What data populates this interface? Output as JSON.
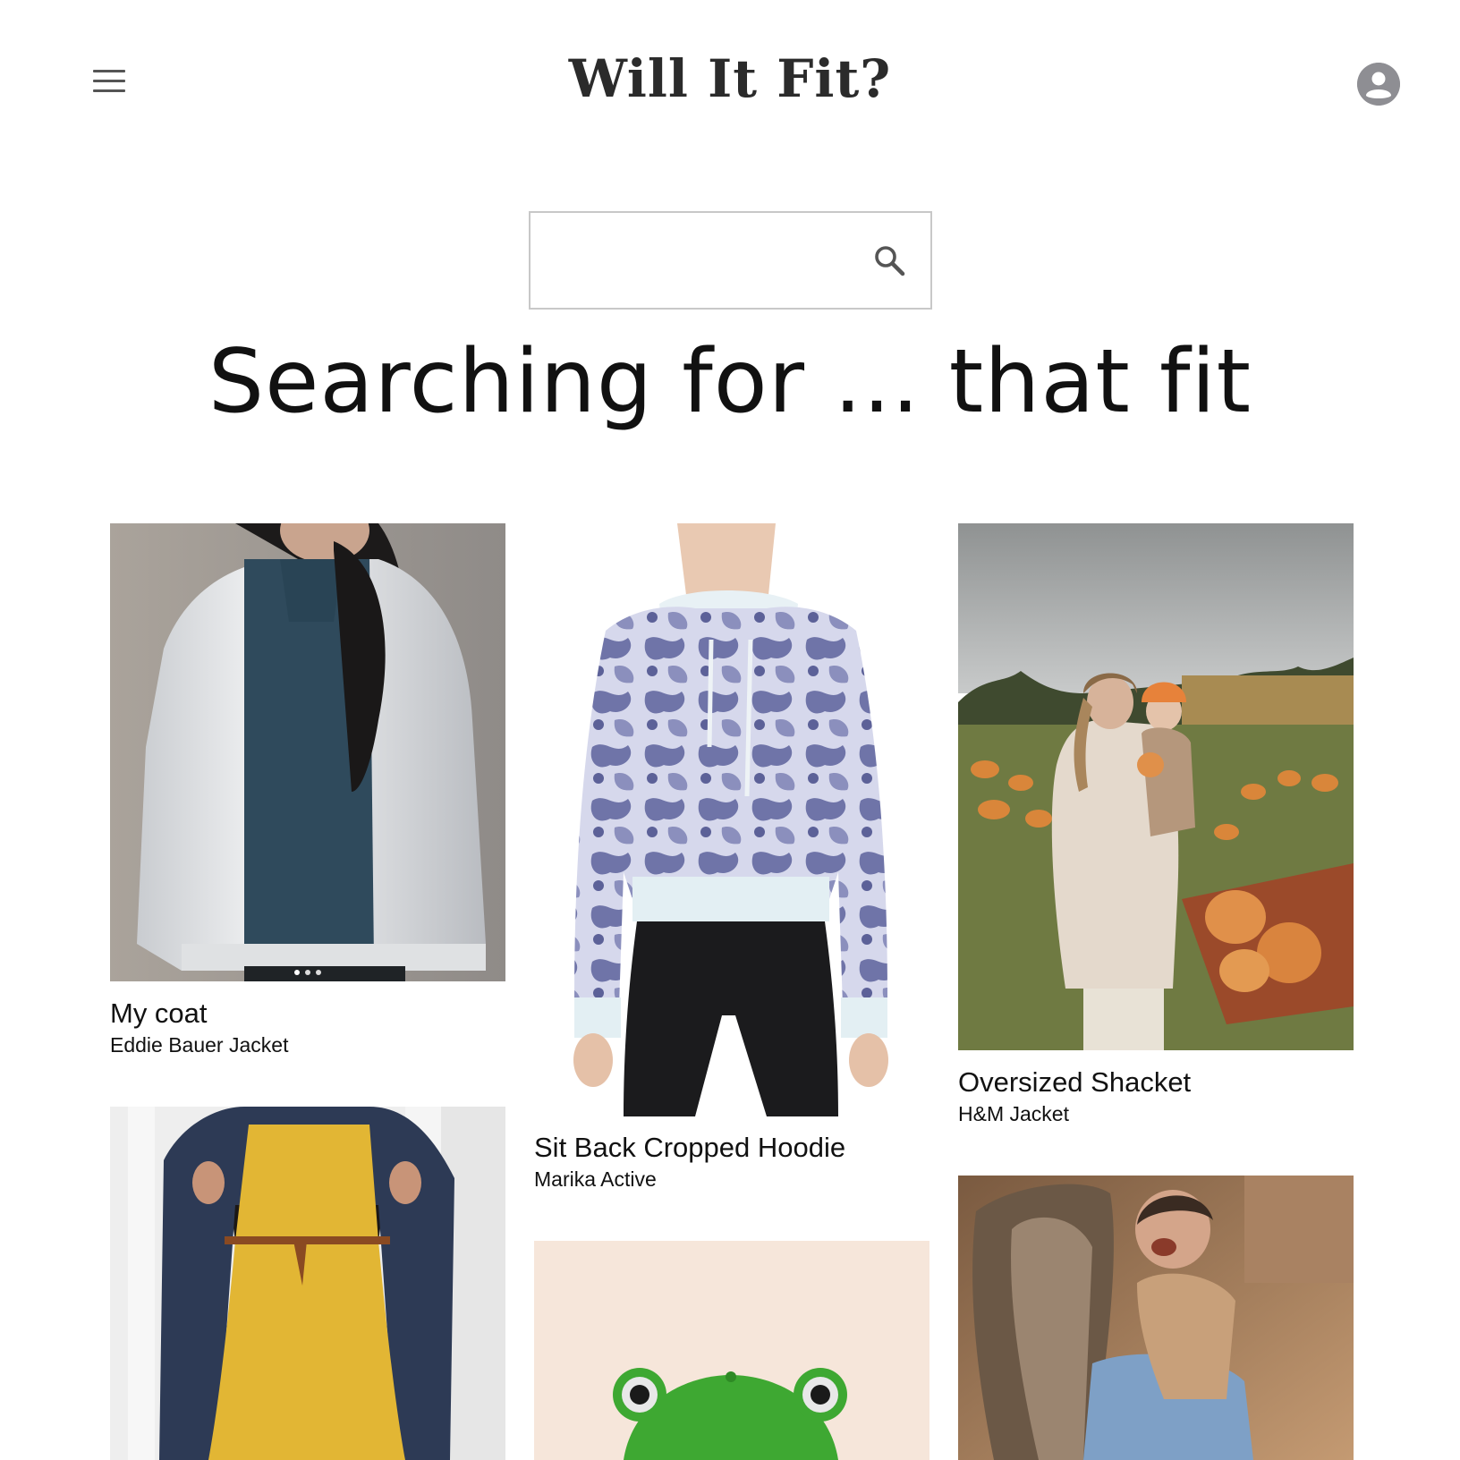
{
  "header": {
    "brand": "Will It Fit?"
  },
  "search": {
    "placeholder": "",
    "value": ""
  },
  "headline": "Searching for ... that fit",
  "items": [
    {
      "title": "My coat",
      "subtitle": "Eddie Bauer Jacket"
    },
    {
      "title": "Sit Back Cropped Hoodie",
      "subtitle": "Marika Active"
    },
    {
      "title": "Oversized Shacket",
      "subtitle": "H&M Jacket"
    },
    {
      "title": "",
      "subtitle": ""
    },
    {
      "title": "",
      "subtitle": ""
    },
    {
      "title": "",
      "subtitle": ""
    }
  ],
  "icons": {
    "menu": "menu-icon",
    "avatar": "account-circle-icon",
    "search": "search-icon"
  },
  "colors": {
    "text": "#111111",
    "brand": "#2b2b2b",
    "icon": "#555555",
    "avatar": "#8e8e93",
    "border": "#c8c8c8"
  }
}
